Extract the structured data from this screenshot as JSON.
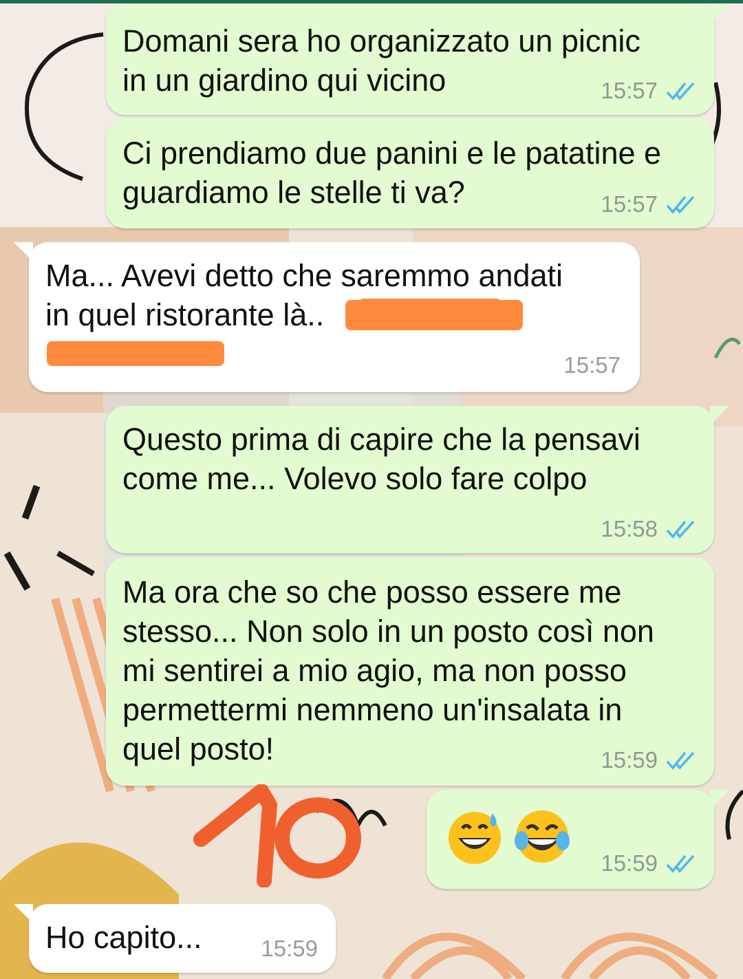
{
  "messages": [
    {
      "id": "m1",
      "direction": "outgoing",
      "text": "Domani sera ho organizzato un picnic\nin un giardino qui vicino",
      "time": "15:57",
      "status": "read"
    },
    {
      "id": "m2",
      "direction": "outgoing",
      "text": "Ci prendiamo due panini e le patatine e\nguardiamo le stelle ti va?",
      "time": "15:57",
      "status": "read"
    },
    {
      "id": "m3",
      "direction": "incoming",
      "text": "Ma... Avevi detto che saremmo andati\nin quel ristorante là..",
      "time": "15:57",
      "redacted": true
    },
    {
      "id": "m4",
      "direction": "outgoing",
      "text": "Questo prima di capire che la pensavi\ncome me... Volevo solo fare colpo",
      "time": "15:58",
      "status": "read"
    },
    {
      "id": "m5",
      "direction": "outgoing",
      "text": "Ma ora che so che posso essere me\nstesso... Non solo in un posto così non\nmi sentirei a mio agio, ma non posso\npermettermi nemmeno un'insalata in\nquel posto!",
      "time": "15:59",
      "status": "read"
    },
    {
      "id": "m6",
      "direction": "outgoing",
      "emojis": [
        "grinning-sweat-emoji",
        "tears-of-joy-emoji"
      ],
      "time": "15:59",
      "status": "read"
    },
    {
      "id": "m7",
      "direction": "incoming",
      "text": "Ho capito...",
      "time": "15:59"
    }
  ],
  "colors": {
    "outgoing_bubble": "#e2fbd0",
    "incoming_bubble": "#ffffff",
    "read_ticks": "#4fb6ec",
    "redaction": "#ff8a3d",
    "annotation": "#f0602e"
  },
  "annotation": {
    "text": "10",
    "style": "handwritten-scribble"
  }
}
